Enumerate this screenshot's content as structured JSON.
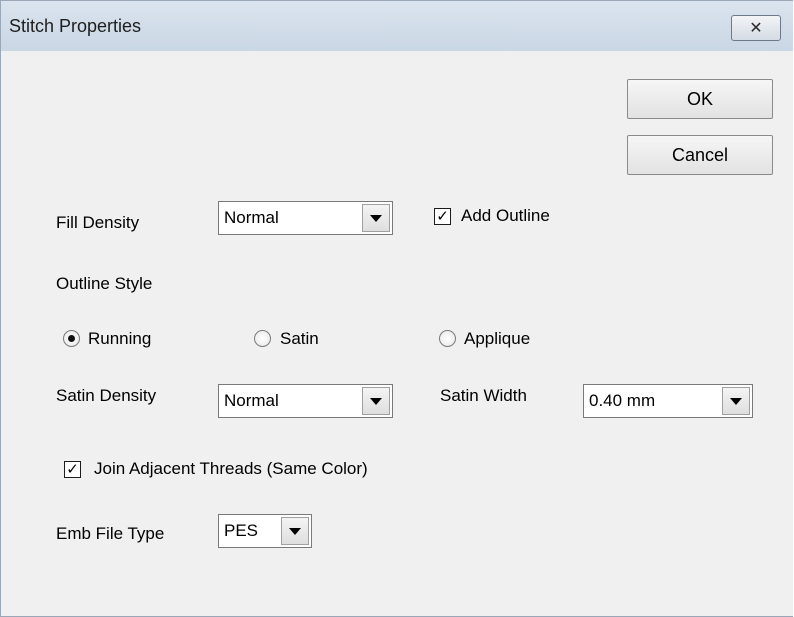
{
  "window": {
    "title": "Stitch Properties",
    "close_glyph": "✕"
  },
  "buttons": {
    "ok": "OK",
    "cancel": "Cancel"
  },
  "fill_density": {
    "label": "Fill Density",
    "value": "Normal"
  },
  "add_outline": {
    "label": "Add Outline",
    "checked": true,
    "glyph": "✓"
  },
  "outline_style": {
    "label": "Outline Style",
    "options": [
      {
        "label": "Running",
        "selected": true
      },
      {
        "label": "Satin",
        "selected": false
      },
      {
        "label": "Applique",
        "selected": false
      }
    ]
  },
  "satin_density": {
    "label": "Satin Density",
    "value": "Normal"
  },
  "satin_width": {
    "label": "Satin Width",
    "value": "0.40 mm"
  },
  "join_adjacent": {
    "label": "Join Adjacent Threads (Same Color)",
    "checked": true,
    "glyph": "✓"
  },
  "emb_file_type": {
    "label": "Emb File Type",
    "value": "PES"
  },
  "icons": {
    "close": "close-icon",
    "dropdown": "chevron-down-icon"
  }
}
